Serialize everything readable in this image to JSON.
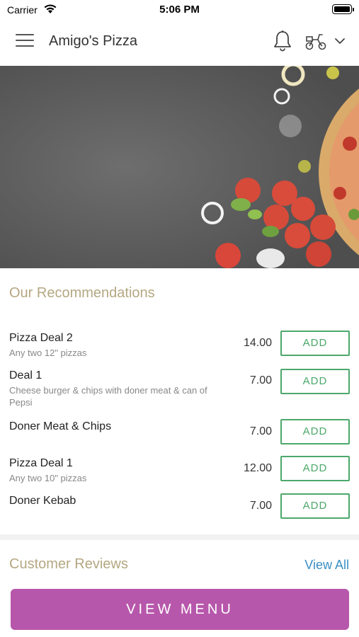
{
  "status_bar": {
    "carrier": "Carrier",
    "time": "5:06 PM",
    "wifi_icon": "wifi-icon",
    "battery_icon": "battery-icon"
  },
  "header": {
    "title": "Amigo's Pizza",
    "menu_icon": "hamburger-menu-icon",
    "notification_icon": "bell-icon",
    "delivery_icon": "scooter-icon",
    "dropdown_icon": "chevron-down-icon"
  },
  "hero": {
    "image": "pizza-ingredients-banner"
  },
  "recommendations": {
    "title": "Our Recommendations",
    "add_label": "ADD",
    "items": [
      {
        "name": "Pizza Deal 2",
        "description": "Any two 12\" pizzas",
        "price": "14.00"
      },
      {
        "name": "Deal 1",
        "description": "Cheese burger & chips with doner meat & can of Pepsi",
        "price": "7.00"
      },
      {
        "name": "Doner Meat & Chips",
        "description": "",
        "price": "7.00"
      },
      {
        "name": "Pizza Deal 1",
        "description": "Any two 10\" pizzas",
        "price": "12.00"
      },
      {
        "name": "Doner Kebab",
        "description": "",
        "price": "7.00"
      }
    ]
  },
  "reviews": {
    "title": "Customer Reviews",
    "view_all": "View All"
  },
  "footer": {
    "view_menu": "VIEW MENU"
  },
  "colors": {
    "accent_title": "#b4a781",
    "add_green": "#4ca86a",
    "link_blue": "#3a8fc4",
    "primary_purple": "#b757ab"
  }
}
